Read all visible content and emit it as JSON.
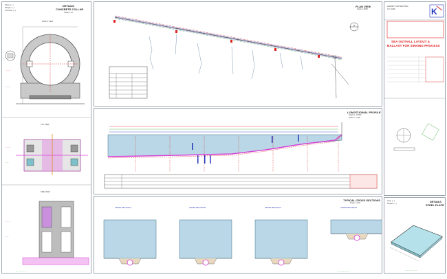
{
  "colors": {
    "water": "#b9d7e6",
    "pipe": "#d63fd6",
    "red": "#e02020",
    "green": "#3aa63a",
    "blue": "#2233bb",
    "grid": "#9aa4ad"
  },
  "left_column": {
    "collar": {
      "info": [
        "Sheet: (—)",
        "Weight: (—)",
        "Concrete: (—)"
      ],
      "title": "DETAILS",
      "subtitle": "CONCRETE COLLAR",
      "scale": "Scale: 1:10",
      "view_label": "FRONT VIEW"
    },
    "top_view": {
      "label": "TOP VIEW"
    },
    "side_view": {
      "label": "SIDE VIEW"
    }
  },
  "plan_view": {
    "title": "PLAN VIEW",
    "scale": "Scale: 1:5000",
    "north_label": "N"
  },
  "longitudinal_profile": {
    "title": "LONGITUDINAL PROFILE",
    "scale_h": "Scale H: 1:5000",
    "scale_v": "Scale V: 1:500"
  },
  "cross_sections": {
    "title": "TYPICAL CROSS SECTIONS",
    "scale": "Scale: 1:100",
    "labels": [
      "CROSS SECTION A",
      "CROSS SECTION B",
      "CROSS SECTION C",
      "CROSS SECTION D"
    ]
  },
  "title_block": {
    "company_line1": "HANDEY CONTRACTING",
    "company_line2": "CO. SARL",
    "drawing_title_line1": "SEA OUTFALL LAYOUT &",
    "drawing_title_line2": "BALLAST FOR SINKING PROCESS"
  },
  "steel_plate": {
    "title": "DETAILS",
    "subtitle": "STEEL PLATE",
    "info": [
      "Area: (—)",
      "Weight: (—)"
    ]
  }
}
